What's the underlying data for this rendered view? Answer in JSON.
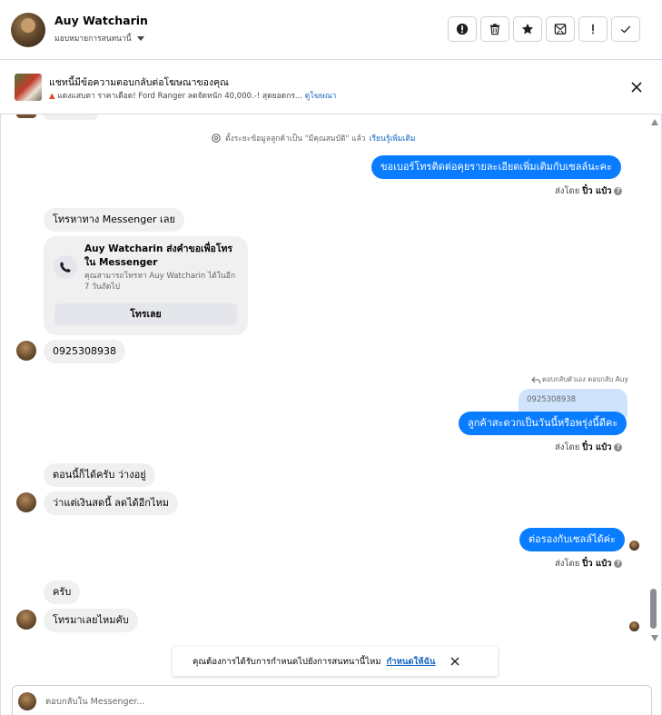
{
  "header": {
    "name": "Auy Watcharin",
    "assign_label": "มอบหมายการสนทนานี้"
  },
  "actions": [
    {
      "icon": "alert-circle-icon"
    },
    {
      "icon": "trash-icon"
    },
    {
      "icon": "star-icon"
    },
    {
      "icon": "mark-unread-icon"
    },
    {
      "icon": "exclamation-icon"
    },
    {
      "icon": "check-icon"
    }
  ],
  "ad_notice": {
    "title": "แชทนี้มีข้อความตอบกลับต่อโฆษณาของคุณ",
    "description": "แดงแสบตา ราคาเดือด! Ford Ranger ลดจัดหนัก 40,000.-! สุดยอดกร...",
    "view_ad_link": "ดูโฆษณา"
  },
  "system_message": {
    "text": "ตั้งระยะข้อมูลลูกค้าเป็น \"มีคุณสมบัติ\" แล้ว",
    "link": "เรียนรู้เพิ่มเติม"
  },
  "messages": {
    "out1": "ขอเบอร์โทรติดต่อคุยรายละเอียดเพิ่มเติมกับเซลล์นะคะ",
    "in_call_label": "โทรหาทาง Messenger เลย",
    "in_phone": "0925308938",
    "reply_label": "ตอบกลับตัวเอง ตอบกลับ Auy",
    "reply_quote": "0925308938",
    "out2": "ลูกค้าสะดวกเป็นวันนี้หรือพรุ่งนี้ดีคะ",
    "in_now": "ตอนนี้ก็ได้ครับ ว่างอยู่",
    "in_price": "ว่าแต่เงินสดนี้ ลดได้อีกไหม",
    "out3": "ต่อรองกับเซลล์ได้ค่ะ",
    "in_yes": "ครับ",
    "in_call_me": "โทรมาเลยไหมคับ"
  },
  "sent_by": {
    "prefix": "ส่งโดย",
    "name": "ปิ๋ว แป๋ว",
    "help_glyph": "?"
  },
  "call_card": {
    "title": "Auy Watcharin ส่งคำขอเพื่อโทรใน Messenger",
    "description": "คุณสามารถโทรหา Auy Watcharin ได้ในอีก 7 วันถัดไป",
    "button": "โทรเลย"
  },
  "followup": {
    "text": "คุณต้องการได้รับการกำหนดไปยังการสนทนานี้ไหม",
    "link": "กำหนดให้ฉัน"
  },
  "compose": {
    "placeholder": "ตอบกลับใน Messenger..."
  },
  "colors": {
    "accent": "#0a7cff",
    "incoming_bubble": "#f0f0f0",
    "reply_quote_bg": "#cfe4fc",
    "link": "#1565c0"
  }
}
